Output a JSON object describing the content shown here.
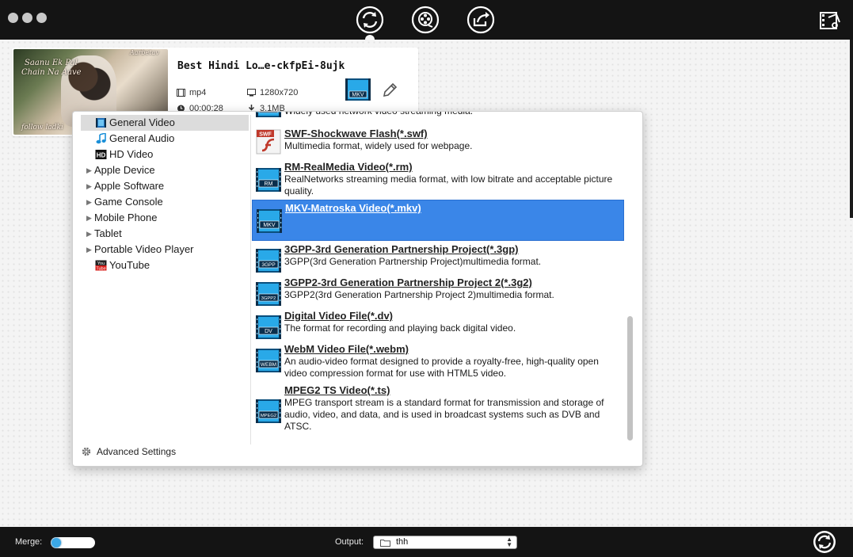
{
  "toolbar": {
    "icons": [
      "convert-icon",
      "media-icon",
      "share-icon",
      "film-settings-icon"
    ],
    "active": "convert-icon"
  },
  "video": {
    "title": "Best Hindi Lo…e-ckfpEi-8ujk",
    "container": "mp4",
    "resolution": "1280x720",
    "duration": "00:00:28",
    "size": "3.1MB",
    "thumbnail_caption_line1": "Saanu Ek Pal",
    "thumbnail_caption_line2": "Chain Na Aave",
    "thumbnail_caption_top": "Aarbetav",
    "thumbnail_caption_bottom": "follow ladki",
    "target_format_badge": "MKV"
  },
  "categories": [
    {
      "label": "General Video",
      "selected": true,
      "icon": "film-icon",
      "expandable": false
    },
    {
      "label": "General Audio",
      "selected": false,
      "icon": "music-note-icon",
      "expandable": false
    },
    {
      "label": "HD Video",
      "selected": false,
      "icon": "hd-icon",
      "expandable": false
    },
    {
      "label": "Apple Device",
      "selected": false,
      "expandable": true
    },
    {
      "label": "Apple Software",
      "selected": false,
      "expandable": true
    },
    {
      "label": "Game Console",
      "selected": false,
      "expandable": true
    },
    {
      "label": "Mobile Phone",
      "selected": false,
      "expandable": true
    },
    {
      "label": "Tablet",
      "selected": false,
      "expandable": true
    },
    {
      "label": "Portable Video Player",
      "selected": false,
      "expandable": true
    },
    {
      "label": "YouTube",
      "selected": false,
      "icon": "youtube-icon",
      "expandable": false
    }
  ],
  "formats": [
    {
      "badge": "",
      "name": "",
      "desc": "Widely used network video streaming media.",
      "partial": true
    },
    {
      "badge": "SWF",
      "name": "SWF-Shockwave Flash(*.swf)",
      "desc": "Multimedia format, widely used for webpage.",
      "icon": "flash-icon"
    },
    {
      "badge": "RM",
      "name": "RM-RealMedia Video(*.rm)",
      "desc": "RealNetworks streaming media format, with low bitrate and acceptable picture quality."
    },
    {
      "badge": "MKV",
      "name": "MKV-Matroska Video(*.mkv)",
      "desc": "",
      "selected": true
    },
    {
      "badge": "3GPP",
      "name": "3GPP-3rd Generation Partnership Project(*.3gp)",
      "desc": "3GPP(3rd Generation Partnership Project)multimedia format."
    },
    {
      "badge": "3GPP2",
      "name": "3GPP2-3rd Generation Partnership Project 2(*.3g2)",
      "desc": "3GPP2(3rd Generation Partnership Project 2)multimedia format."
    },
    {
      "badge": "DV",
      "name": "Digital Video File(*.dv)",
      "desc": "The format for recording and playing back digital video."
    },
    {
      "badge": "WEBM",
      "name": "WebM Video File(*.webm)",
      "desc": "An audio-video format designed to provide a royalty-free, high-quality open video compression format for use with HTML5 video."
    },
    {
      "badge": "MPEG2",
      "name": "MPEG2 TS Video(*.ts)",
      "desc": "MPEG transport stream is a standard format for transmission and storage of audio, video, and data, and is used in broadcast systems such as DVB and ATSC."
    }
  ],
  "advanced_settings_label": "Advanced Settings",
  "bottom": {
    "merge_label": "Merge:",
    "output_label": "Output:",
    "output_value": "thh"
  },
  "colors": {
    "selection": "#3a86e8",
    "bar": "#141414",
    "toggle": "#3ba8e6"
  }
}
